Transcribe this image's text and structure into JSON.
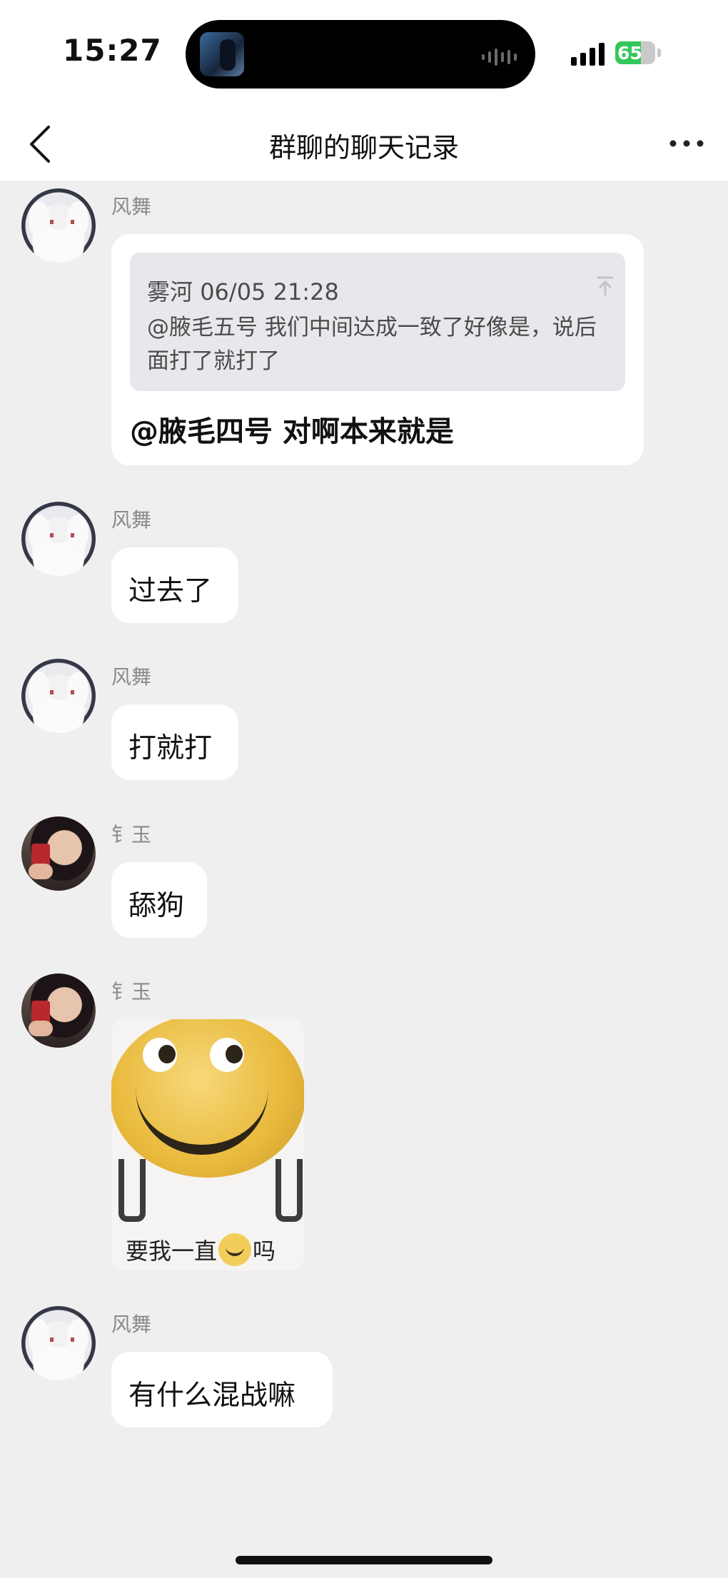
{
  "status_bar": {
    "time": "15:27",
    "battery": "65",
    "battery_level_percent": 65,
    "signal_bars": 4,
    "accent_color": "#34c759"
  },
  "nav": {
    "title": "群聊的聊天记录",
    "back_icon": "chevron-left-icon",
    "more_icon": "ellipsis-icon"
  },
  "messages": [
    {
      "sender": "风舞",
      "quote": {
        "author": "雾河",
        "time": "06/05 21:28",
        "text": "@腋毛五号 我们中间达成一致了好像是，说后面打了就打了"
      },
      "text": "@腋毛四号 对啊本来就是"
    },
    {
      "sender": "风舞",
      "text": "过去了"
    },
    {
      "sender": "风舞",
      "text": "打就打"
    },
    {
      "sender": "钅玉",
      "text": "舔狗"
    },
    {
      "sender": "钅玉",
      "sticker": {
        "caption_before": "要我一直",
        "caption_after": "吗",
        "icon": "smiley-icon"
      }
    },
    {
      "sender": "风舞",
      "text": "有什么混战嘛"
    }
  ]
}
